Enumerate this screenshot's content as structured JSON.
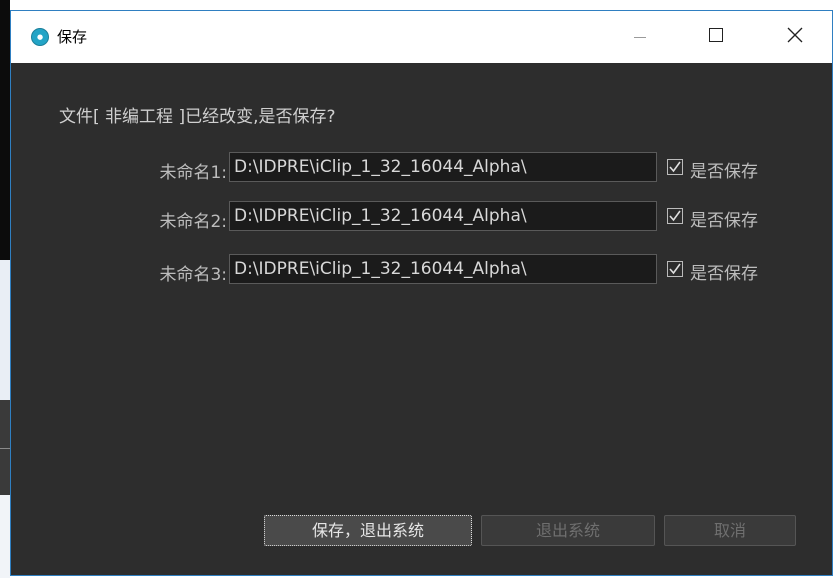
{
  "window": {
    "title": "保存",
    "icon": "app-logo-icon"
  },
  "dialog": {
    "message": "文件[ 非编工程 ]已经改变,是否保存?",
    "items": [
      {
        "label": "未命名1:",
        "path": "D:\\IDPRE\\iClip_1_32_16044_Alpha\\",
        "checked": true,
        "check_label": "是否保存"
      },
      {
        "label": "未命名2:",
        "path": "D:\\IDPRE\\iClip_1_32_16044_Alpha\\",
        "checked": true,
        "check_label": "是否保存"
      },
      {
        "label": "未命名3:",
        "path": "D:\\IDPRE\\iClip_1_32_16044_Alpha\\",
        "checked": true,
        "check_label": "是否保存"
      }
    ],
    "buttons": {
      "save_exit": "保存，退出系统",
      "exit": "退出系统",
      "cancel": "取消"
    }
  },
  "colors": {
    "window_bg": "#2d2d2d",
    "border_accent": "#2f7fc1",
    "text": "#cfcfcf",
    "disabled_text": "#6f6f6f"
  }
}
